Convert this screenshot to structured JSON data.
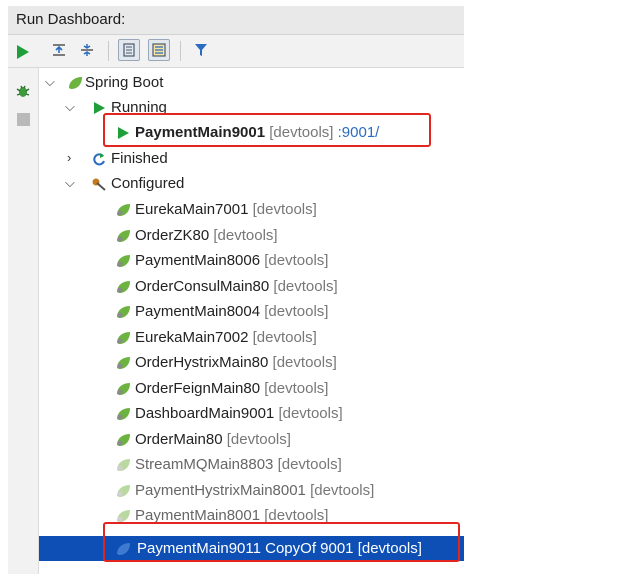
{
  "panel": {
    "title": "Run Dashboard:"
  },
  "toolbar": {
    "expand_all_icon": "expand-all-icon",
    "collapse_all_icon": "collapse-all-icon",
    "group_by_type_icon": "group-by-type-icon",
    "group_by_status_icon": "group-by-status-icon",
    "filter_icon": "filter-icon"
  },
  "side_actions": [
    "run-icon",
    "debug-icon",
    "stop-icon"
  ],
  "tree": {
    "root": "Spring Boot",
    "running_label": "Running",
    "running_item": {
      "name": "PaymentMain9001",
      "tag": "[devtools]",
      "port": ":9001/"
    },
    "finished_label": "Finished",
    "configured_label": "Configured",
    "configured": [
      {
        "name": "EurekaMain7001",
        "tag": "[devtools]"
      },
      {
        "name": "OrderZK80",
        "tag": "[devtools]"
      },
      {
        "name": "PaymentMain8006",
        "tag": "[devtools]"
      },
      {
        "name": "OrderConsulMain80",
        "tag": "[devtools]"
      },
      {
        "name": "PaymentMain8004",
        "tag": "[devtools]"
      },
      {
        "name": "EurekaMain7002",
        "tag": "[devtools]"
      },
      {
        "name": "OrderHystrixMain80",
        "tag": "[devtools]"
      },
      {
        "name": "OrderFeignMain80",
        "tag": "[devtools]"
      },
      {
        "name": "DashboardMain9001",
        "tag": "[devtools]"
      },
      {
        "name": "OrderMain80",
        "tag": "[devtools]"
      },
      {
        "name": "StreamMQMain8803",
        "tag": "[devtools]"
      },
      {
        "name": "PaymentHystrixMain8001",
        "tag": "[devtools]"
      },
      {
        "name": "PaymentMain8001",
        "tag": "[devtools]"
      }
    ],
    "selected": {
      "name": "PaymentMain9011 CopyOf 9001",
      "tag": "[devtools]"
    }
  },
  "colors": {
    "selection": "#0d4fb5",
    "highlight_box": "#e3251f",
    "run_green": "#1f9e3a",
    "spring_green": "#6db33f"
  }
}
